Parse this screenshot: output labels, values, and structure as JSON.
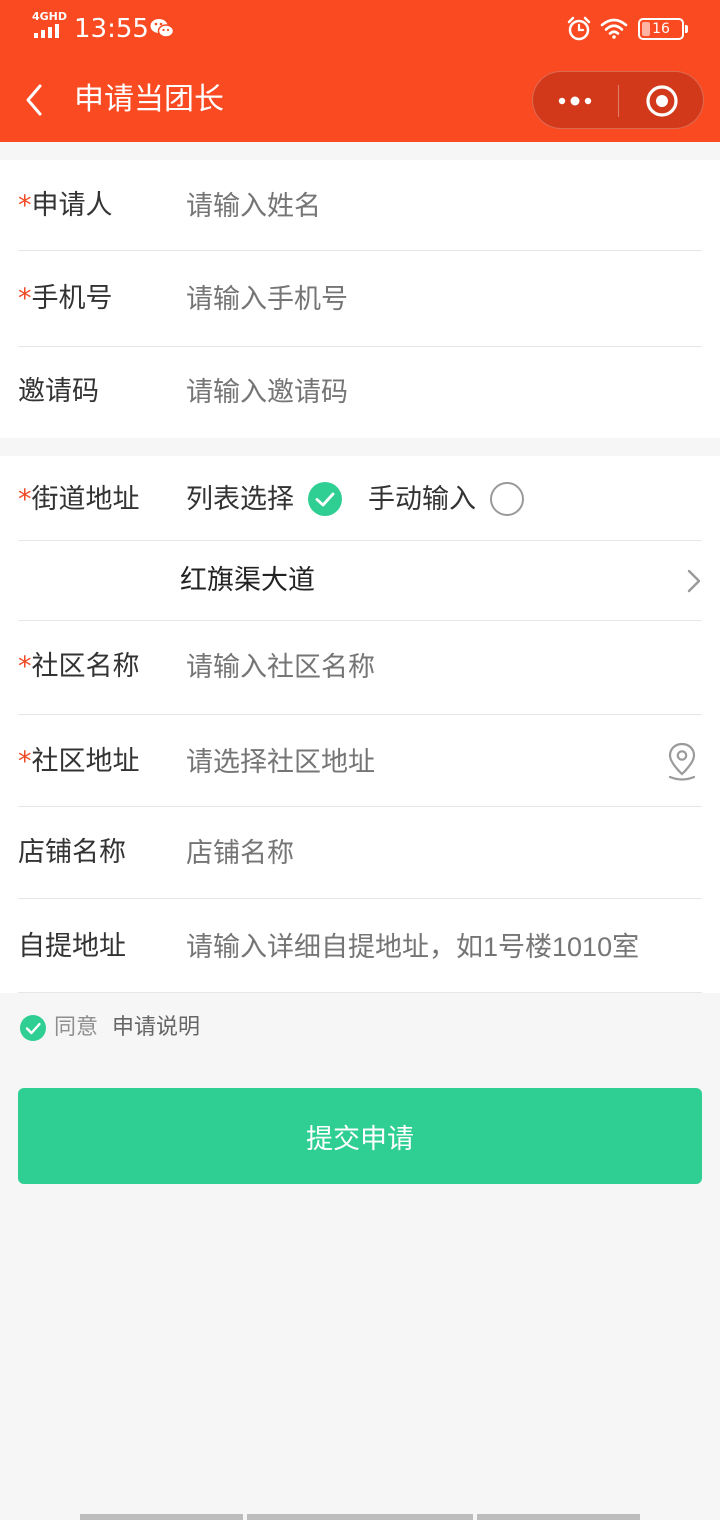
{
  "status_bar": {
    "network": "4GHD",
    "time": "13:55",
    "battery": "16",
    "icons": [
      "signal-icon",
      "wechat-icon",
      "alarm-icon",
      "wifi-icon",
      "battery-icon"
    ]
  },
  "nav": {
    "title": "申请当团长",
    "back_icon": "chevron-left-icon",
    "more_icon": "more-dots-icon",
    "close_icon": "target-close-icon"
  },
  "form": {
    "applicant": {
      "label": "申请人",
      "required": "*",
      "placeholder": "请输入姓名"
    },
    "phone": {
      "label": "手机号",
      "required": "*",
      "placeholder": "请输入手机号"
    },
    "invite_code": {
      "label": "邀请码",
      "placeholder": "请输入邀请码"
    },
    "street": {
      "label": "街道地址",
      "required": "*",
      "option_list": "列表选择",
      "option_manual": "手动输入",
      "selected": "列表选择",
      "value": "红旗渠大道"
    },
    "community_name": {
      "label": "社区名称",
      "required": "*",
      "placeholder": "请输入社区名称"
    },
    "community_address": {
      "label": "社区地址",
      "required": "*",
      "placeholder": "请选择社区地址",
      "icon": "location-pin-icon"
    },
    "shop_name": {
      "label": "店铺名称",
      "placeholder": "店铺名称"
    },
    "pickup_address": {
      "label": "自提地址",
      "placeholder": "请输入详细自提地址，如1号楼1010室"
    }
  },
  "agreement": {
    "text": "同意",
    "link": "申请说明",
    "checked": true
  },
  "submit_label": "提交申请",
  "colors": {
    "brand": "#fa4a22",
    "accent_green": "#2fce93",
    "required_star": "#f04a25"
  }
}
